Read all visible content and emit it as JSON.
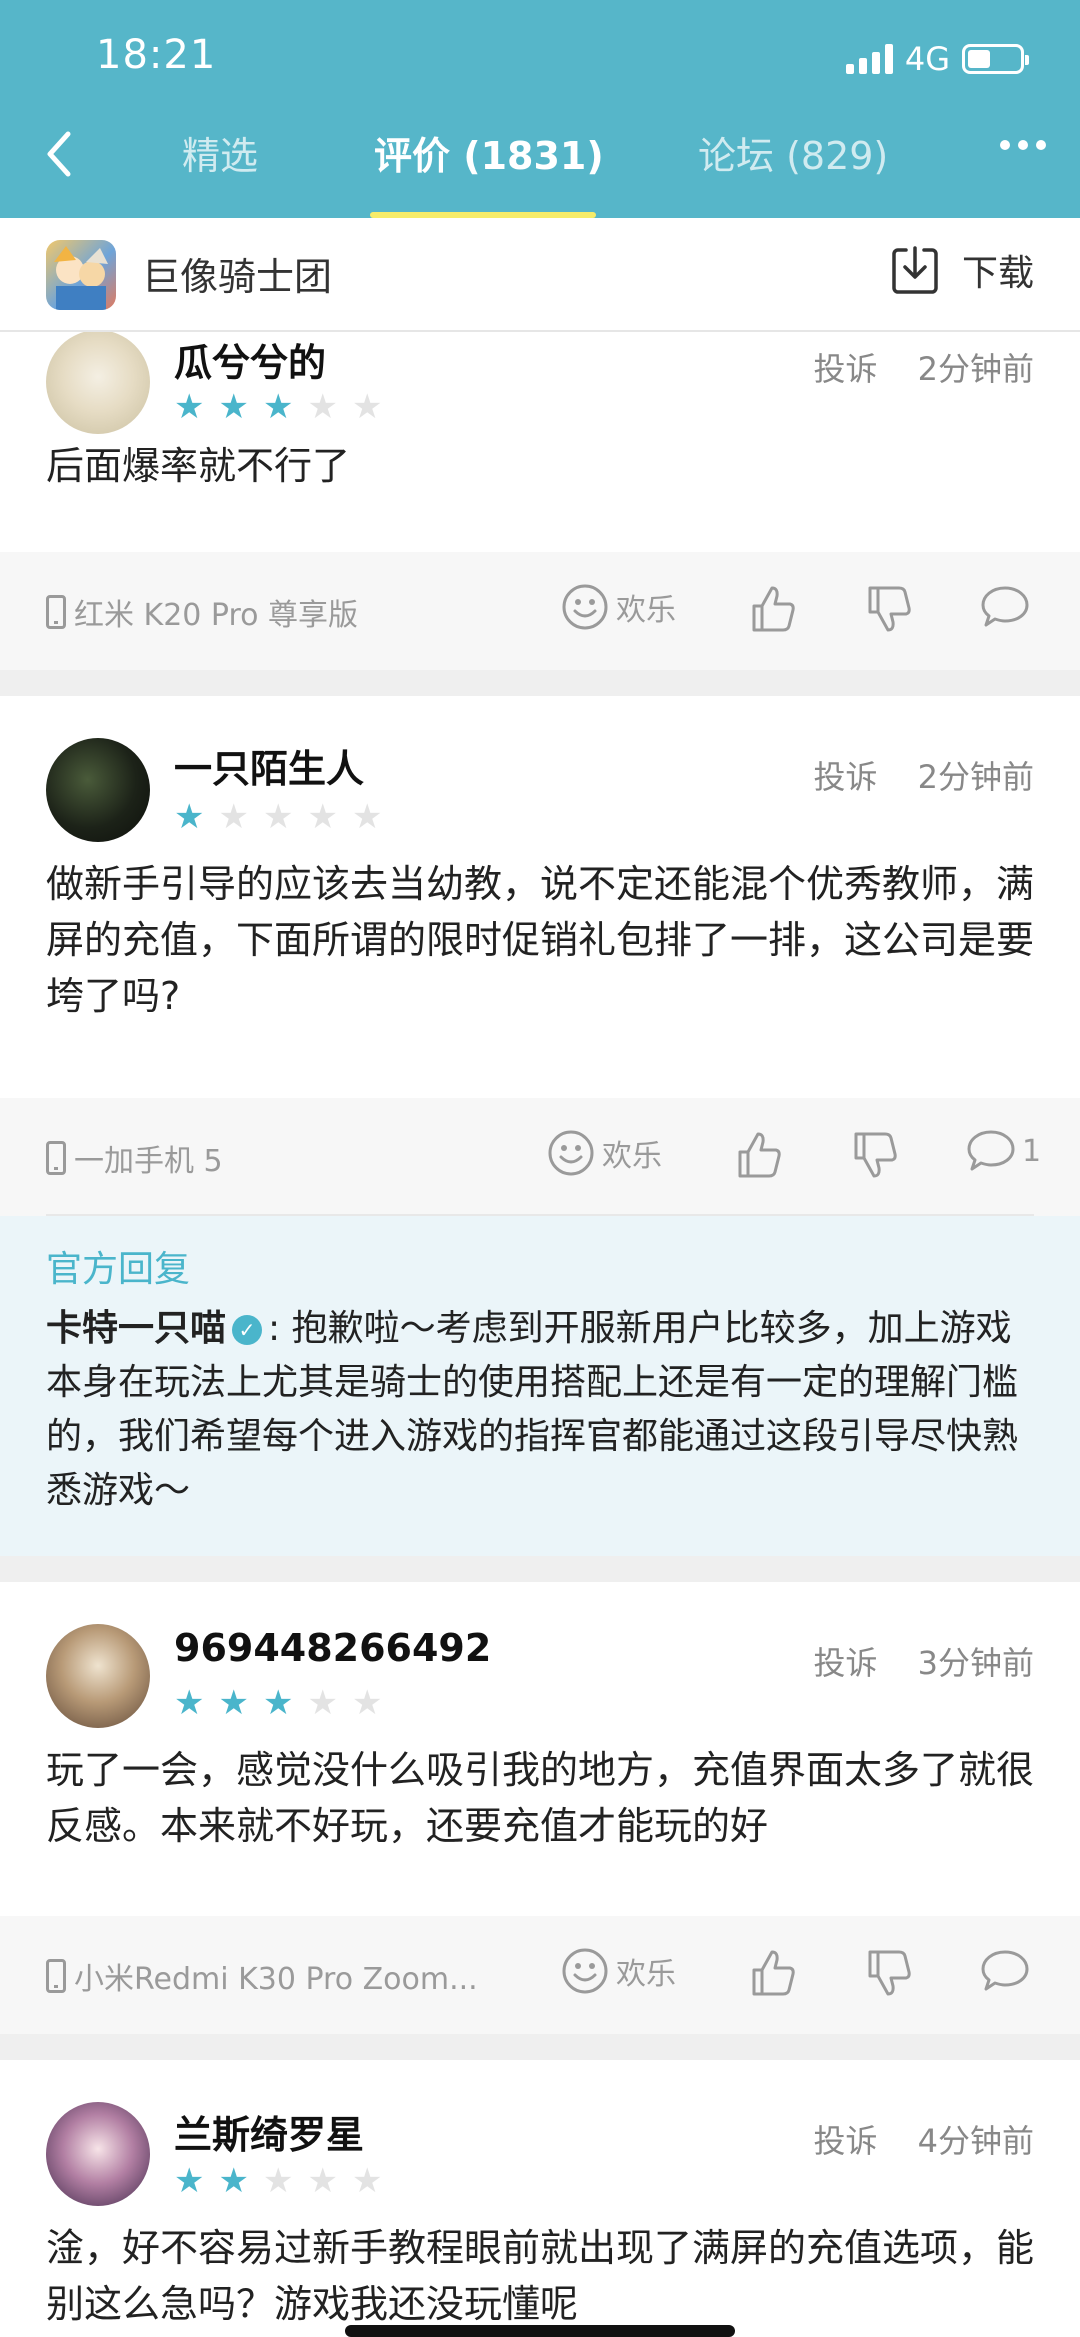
{
  "status": {
    "time": "18:21",
    "network": "4G"
  },
  "nav": {
    "tabs": [
      {
        "label": "精选"
      },
      {
        "label": "评价 (1831)"
      },
      {
        "label": "论坛 (829)"
      }
    ]
  },
  "app": {
    "name": "巨像骑士团",
    "download_label": "下载"
  },
  "reviews": [
    {
      "username": "瓜兮兮的",
      "rating": 3,
      "report_label": "投诉",
      "time": "2分钟前",
      "text": "后面爆率就不行了",
      "device": "红米 K20 Pro 尊享版",
      "reaction": "欢乐",
      "comment_count": ""
    },
    {
      "username": "一只陌生人",
      "rating": 1,
      "report_label": "投诉",
      "time": "2分钟前",
      "text": "做新手引导的应该去当幼教，说不定还能混个优秀教师，满屏的充值，下面所谓的限时促销礼包排了一排，这公司是要垮了吗?",
      "device": "一加手机 5",
      "reaction": "欢乐",
      "comment_count": "1"
    },
    {
      "username": "969448266492",
      "rating": 3,
      "report_label": "投诉",
      "time": "3分钟前",
      "text": "玩了一会，感觉没什么吸引我的地方，充值界面太多了就很反感。本来就不好玩，还要充值才能玩的好",
      "device": "小米Redmi K30 Pro Zoom...",
      "reaction": "欢乐",
      "comment_count": ""
    },
    {
      "username": "兰斯绮罗星",
      "rating": 2,
      "report_label": "投诉",
      "time": "4分钟前",
      "text": "淦，好不容易过新手教程眼前就出现了满屏的充值选项，能别这么急吗？游戏我还没玩懂呢"
    }
  ],
  "official_reply": {
    "title": "官方回复",
    "name": "卡特一只喵",
    "text": ": 抱歉啦～考虑到开服新用户比较多，加上游戏本身在玩法上尤其是骑士的使用搭配上还是有一定的理解门槛的，我们希望每个进入游戏的指挥官都能通过这段引导尽快熟悉游戏～"
  },
  "colors": {
    "accent": "#56b6c9",
    "star_on": "#4ab5cb",
    "indicator": "#f6ec6a"
  },
  "icons": [
    "back-icon",
    "more-icon",
    "download-icon",
    "phone-icon",
    "smile-icon",
    "thumbs-up-icon",
    "thumbs-down-icon",
    "comment-icon",
    "verified-icon"
  ]
}
